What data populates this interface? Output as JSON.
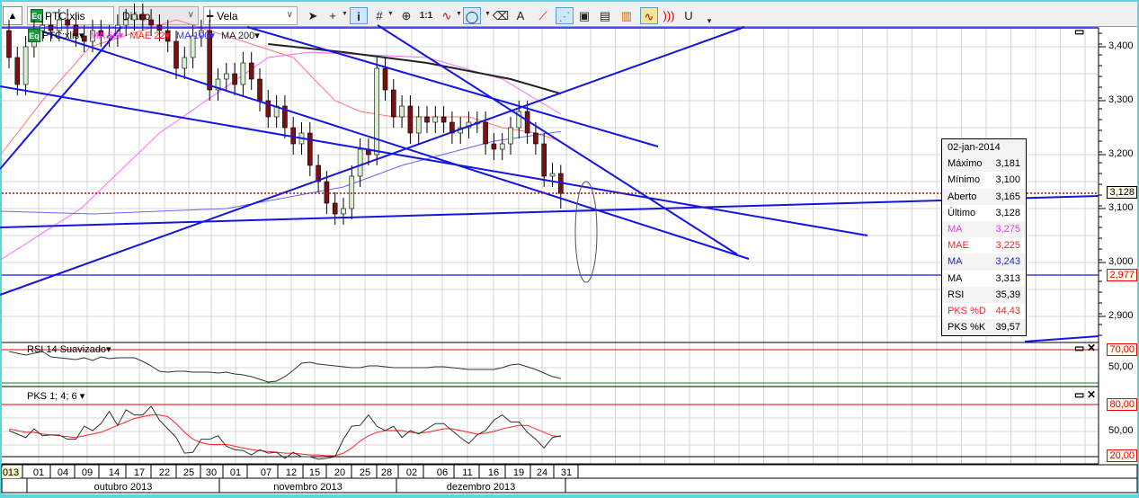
{
  "toolbar": {
    "symbol": "PTC:xlis",
    "symbol_icon": "Eq",
    "period": "Diário",
    "chart_type": "Vela",
    "icons": [
      "cursor-icon",
      "crosshair-icon",
      "info-icon",
      "grid-icon",
      "zoom-icon",
      "one-to-one-icon",
      "indicator-wave-icon",
      "ellipse-icon",
      "eraser-icon",
      "text-tool-icon",
      "fibonacci-icon",
      "magnet-lines-icon",
      "clipboard-icon",
      "copy-chart-icon",
      "export-chart-icon",
      "oscillator-icon",
      "sound-icon",
      "magnet-icon"
    ]
  },
  "legend": {
    "symbol": "PTC:xlis",
    "symbol_icon": "Eq",
    "items": [
      {
        "label": "MA 50",
        "color": "#ff33ff"
      },
      {
        "label": "MAE 22",
        "color": "#ff2020"
      },
      {
        "label": "MA 100",
        "color": "#3333ff"
      },
      {
        "label": "MA 200",
        "color": "#222222"
      }
    ]
  },
  "price_axis": {
    "ticks": [
      "3,400",
      "3,300",
      "3,200",
      "3,100",
      "3,000",
      "2,900"
    ],
    "last_label": "3,128",
    "line_label": "2,977"
  },
  "tooltip": {
    "date": "02-jan-2014",
    "rows": [
      {
        "label": "Máximo",
        "value": "3,181",
        "color": "#000"
      },
      {
        "label": "Mínimo",
        "value": "3,100",
        "color": "#000"
      },
      {
        "label": "Aberto",
        "value": "3,165",
        "color": "#000"
      },
      {
        "label": "Último",
        "value": "3,128",
        "color": "#000"
      },
      {
        "label": "MA",
        "value": "3,275",
        "color": "#ff33ff"
      },
      {
        "label": "MAE",
        "value": "3,225",
        "color": "#ff2020"
      },
      {
        "label": "MA",
        "value": "3,243",
        "color": "#2222ee"
      },
      {
        "label": "MA",
        "value": "3,313",
        "color": "#000"
      },
      {
        "label": "RSI",
        "value": "35,39",
        "color": "#000"
      },
      {
        "label": "PKS %D",
        "value": "44,43",
        "color": "#ff2020"
      },
      {
        "label": "PKS %K",
        "value": "39,57",
        "color": "#000"
      }
    ]
  },
  "rsi": {
    "title": "RSI 14 Suavizado",
    "upper": "70,00",
    "mid": "50,00"
  },
  "pks": {
    "title": "PKS 1; 4; 6",
    "upper": "80,00",
    "mid": "50,00",
    "lower": "20,00"
  },
  "dates": [
    "013",
    "01",
    "04",
    "09",
    "14",
    "17",
    "22",
    "25",
    "30",
    "01",
    "07",
    "12",
    "15",
    "20",
    "25",
    "28",
    "02",
    "06",
    "11",
    "16",
    "19",
    "24",
    "31"
  ],
  "months": [
    "outubro 2013",
    "novembro 2013",
    "dezembro 2013"
  ],
  "chart_data": {
    "type": "candlestick",
    "price_range": [
      2.88,
      3.45
    ],
    "closes": [
      3.38,
      3.33,
      3.4,
      3.43,
      3.44,
      3.43,
      3.45,
      3.44,
      3.42,
      3.41,
      3.43,
      3.42,
      3.42,
      3.44,
      3.45,
      3.46,
      3.45,
      3.44,
      3.43,
      3.41,
      3.36,
      3.38,
      3.42,
      3.43,
      3.32,
      3.34,
      3.35,
      3.33,
      3.37,
      3.34,
      3.3,
      3.27,
      3.29,
      3.25,
      3.22,
      3.24,
      3.18,
      3.15,
      3.11,
      3.09,
      3.1,
      3.16,
      3.21,
      3.2,
      3.36,
      3.32,
      3.27,
      3.29,
      3.24,
      3.27,
      3.26,
      3.27,
      3.26,
      3.24,
      3.25,
      3.26,
      3.26,
      3.22,
      3.21,
      3.22,
      3.25,
      3.28,
      3.24,
      3.22,
      3.16,
      3.165,
      3.128
    ],
    "last": {
      "open": 3.165,
      "high": 3.181,
      "low": 3.1,
      "close": 3.128
    },
    "ma200": [
      [
        31,
        3.405
      ],
      [
        40,
        3.39
      ],
      [
        50,
        3.37
      ],
      [
        60,
        3.34
      ],
      [
        66,
        3.313
      ]
    ],
    "ma100": [
      [
        -1,
        3.095
      ],
      [
        10,
        3.09
      ],
      [
        26,
        3.1
      ],
      [
        40,
        3.14
      ],
      [
        47,
        3.18
      ],
      [
        58,
        3.225
      ],
      [
        66,
        3.243
      ]
    ],
    "ma50": [
      [
        -1,
        3.005
      ],
      [
        8.6,
        3.1
      ],
      [
        18,
        3.24
      ],
      [
        31,
        3.38
      ],
      [
        36,
        3.39
      ],
      [
        50,
        3.38
      ],
      [
        59,
        3.34
      ],
      [
        66,
        3.275
      ]
    ],
    "mae22": [
      [
        -1,
        3.2
      ],
      [
        4,
        3.3
      ],
      [
        9.7,
        3.4
      ],
      [
        20,
        3.45
      ],
      [
        34,
        3.38
      ],
      [
        39,
        3.3
      ],
      [
        42,
        3.28
      ],
      [
        46,
        3.27
      ],
      [
        55,
        3.27
      ],
      [
        59,
        3.25
      ],
      [
        63,
        3.24
      ],
      [
        66,
        3.225
      ]
    ],
    "rsi": [
      68,
      66,
      64,
      66,
      68,
      62,
      61,
      60,
      59,
      61,
      58,
      62,
      60,
      61,
      61,
      61,
      57,
      52,
      46,
      45,
      46,
      46,
      45,
      45,
      45,
      44,
      45,
      43,
      42,
      40,
      37,
      34,
      35,
      40,
      47,
      55,
      56,
      54,
      53,
      52,
      51,
      50,
      50,
      52,
      52,
      51,
      50,
      50,
      50,
      50,
      50,
      51,
      51,
      50,
      49,
      48,
      48,
      48,
      48,
      50,
      53,
      54,
      51,
      48,
      44,
      40,
      38
    ],
    "pks_k": [
      50,
      46,
      42,
      52,
      44,
      45,
      45,
      40,
      40,
      55,
      50,
      58,
      72,
      56,
      74,
      68,
      68,
      78,
      62,
      52,
      42,
      24,
      25,
      40,
      40,
      44,
      32,
      28,
      27,
      22,
      28,
      24,
      25,
      18,
      25,
      20,
      20,
      17,
      18,
      20,
      40,
      55,
      56,
      68,
      55,
      50,
      55,
      42,
      50,
      46,
      52,
      58,
      58,
      50,
      42,
      35,
      45,
      50,
      62,
      68,
      60,
      60,
      48,
      40,
      30,
      42,
      44
    ],
    "pks_d": [
      52,
      50,
      48,
      48,
      46,
      45,
      44,
      43,
      42,
      44,
      46,
      48,
      52,
      56,
      60,
      64,
      66,
      68,
      68,
      66,
      58,
      48,
      40,
      36,
      34,
      34,
      34,
      32,
      30,
      28,
      27,
      26,
      25,
      24,
      24,
      23,
      22,
      22,
      21,
      21,
      24,
      30,
      38,
      44,
      48,
      50,
      50,
      50,
      48,
      47,
      48,
      50,
      52,
      52,
      50,
      48,
      46,
      47,
      49,
      52,
      54,
      56,
      56,
      52,
      48,
      44,
      43
    ]
  }
}
